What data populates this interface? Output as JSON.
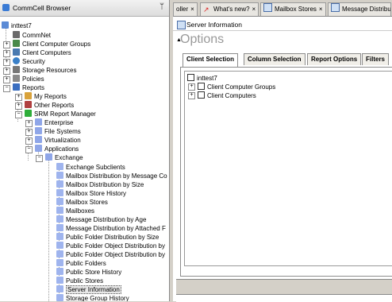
{
  "left_panel": {
    "title": "CommCell Browser",
    "pin": "ᵖ",
    "tree": [
      {
        "label": "inttest7",
        "icon": "commcell-icon"
      },
      {
        "label": "CommNet",
        "icon": "commnet-icon"
      },
      {
        "label": "Client Computer Groups",
        "icon": "client-groups-icon"
      },
      {
        "label": "Client Computers",
        "icon": "client-computers-icon"
      },
      {
        "label": "Security",
        "icon": "security-icon"
      },
      {
        "label": "Storage Resources",
        "icon": "storage-icon"
      },
      {
        "label": "Policies",
        "icon": "policies-icon"
      },
      {
        "label": "Reports",
        "icon": "reports-icon"
      },
      {
        "label": "My Reports",
        "icon": "my-reports-icon"
      },
      {
        "label": "Other Reports",
        "icon": "other-reports-icon"
      },
      {
        "label": "SRM Report Manager",
        "icon": "srm-icon"
      },
      {
        "label": "Enterprise",
        "icon": "folder-icon"
      },
      {
        "label": "File Systems",
        "icon": "folder-icon"
      },
      {
        "label": "Virtualization",
        "icon": "folder-icon"
      },
      {
        "label": "Applications",
        "icon": "folder-icon"
      },
      {
        "label": "Exchange",
        "icon": "folder-icon"
      },
      {
        "label": "Exchange Subclients",
        "icon": "report-icon"
      },
      {
        "label": "Mailbox Distribution by Message Co",
        "icon": "report-icon"
      },
      {
        "label": "Mailbox Distribution by Size",
        "icon": "report-icon"
      },
      {
        "label": "Mailbox Store History",
        "icon": "report-icon"
      },
      {
        "label": "Mailbox Stores",
        "icon": "report-icon"
      },
      {
        "label": "Mailboxes",
        "icon": "report-icon"
      },
      {
        "label": "Message Distribution by Age",
        "icon": "report-icon"
      },
      {
        "label": "Message Distribution by Attached F",
        "icon": "report-icon"
      },
      {
        "label": "Public Folder Distribution by Size",
        "icon": "report-icon"
      },
      {
        "label": "Public Folder Object Distribution by",
        "icon": "report-icon"
      },
      {
        "label": "Public Folder Object Distribution by",
        "icon": "report-icon"
      },
      {
        "label": "Public Folders",
        "icon": "report-icon"
      },
      {
        "label": "Public Store History",
        "icon": "report-icon"
      },
      {
        "label": "Public Stores",
        "icon": "report-icon"
      },
      {
        "label": "Server Information",
        "icon": "report-icon"
      },
      {
        "label": "Storage Group History",
        "icon": "report-icon"
      }
    ]
  },
  "tabs": [
    {
      "label": "oller",
      "close": "×"
    },
    {
      "label": "What's new?",
      "close": "×"
    },
    {
      "label": "Mailbox Stores",
      "close": "×"
    },
    {
      "label": "Message Distribut",
      "close": ""
    }
  ],
  "server_bar": {
    "title": "Server Information"
  },
  "options": {
    "title": "Options",
    "collapse_glyph": "▲",
    "tabs": [
      "Client Selection",
      "Column Selection",
      "Report Options",
      "Filters"
    ],
    "selection_tree": [
      {
        "label": "inttest7"
      },
      {
        "label": "Client Computer Groups"
      },
      {
        "label": "Client Computers"
      }
    ]
  },
  "colors": {
    "accent": "#3a7bd5",
    "folder": "#8fa6e8",
    "report": "#9fb4ee",
    "selection": "#e8e8e8"
  }
}
